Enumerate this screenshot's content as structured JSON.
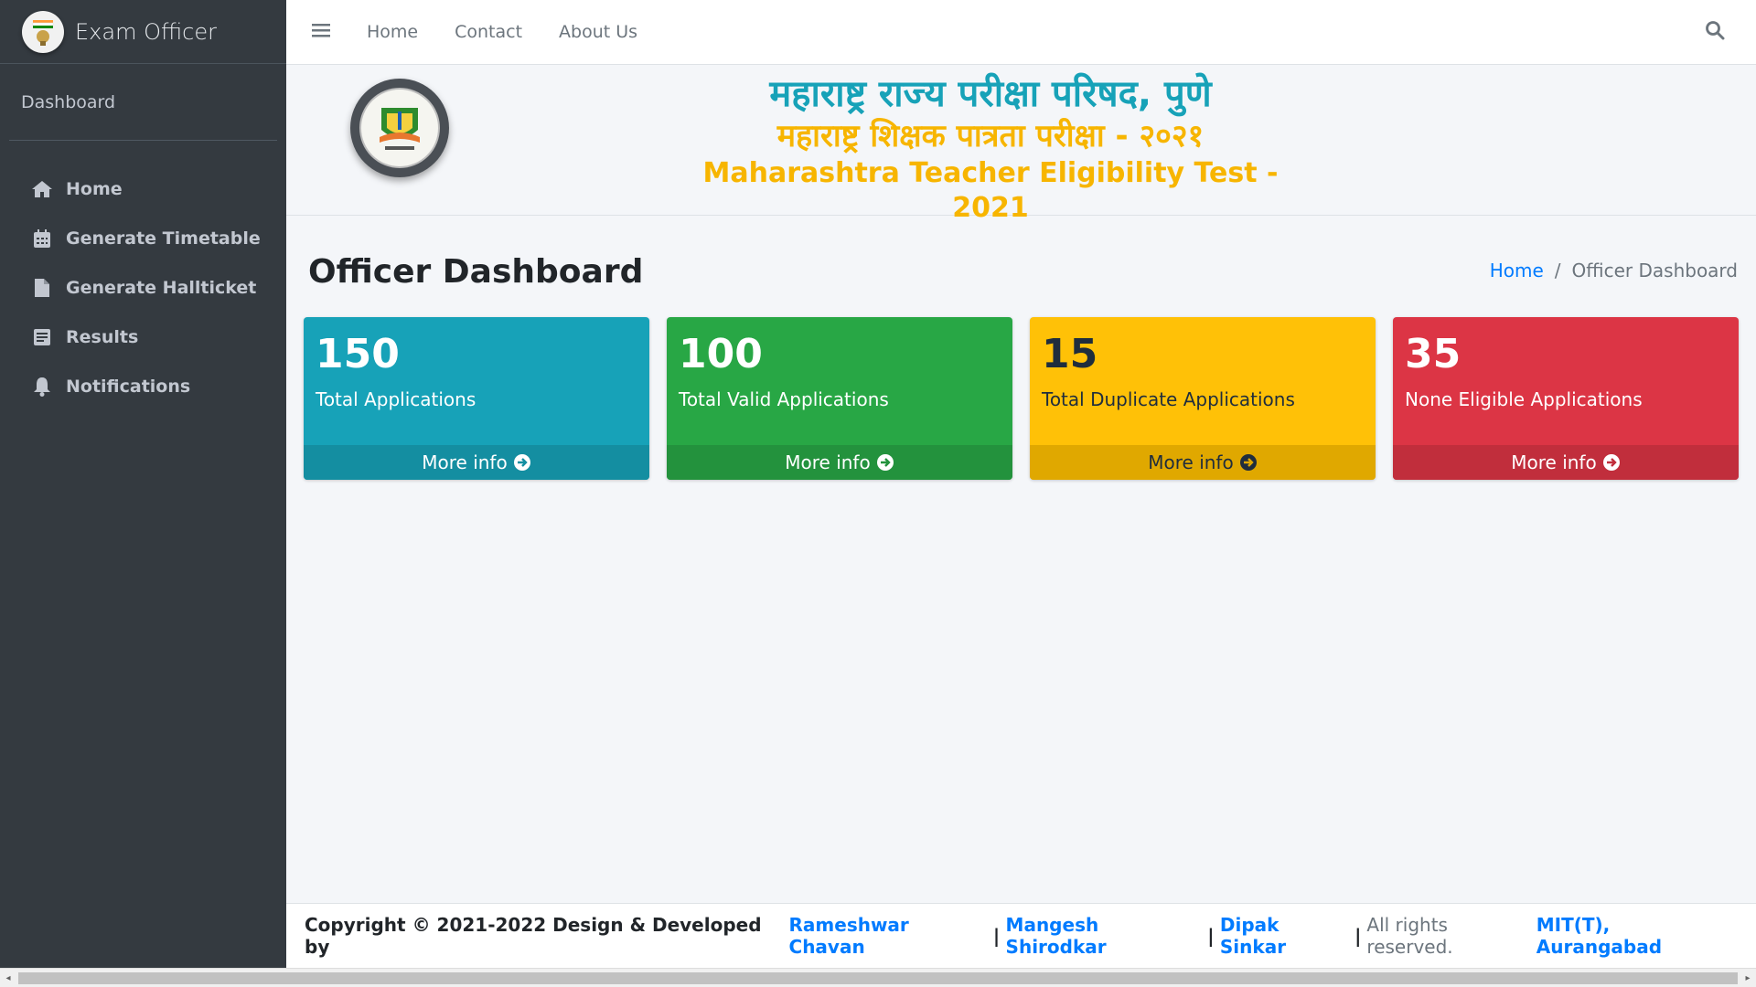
{
  "brand": {
    "title": "Exam Officer"
  },
  "sidebar": {
    "panel_label": "Dashboard",
    "items": [
      {
        "label": "Home",
        "icon": "home-icon"
      },
      {
        "label": "Generate Timetable",
        "icon": "calendar-icon"
      },
      {
        "label": "Generate Hallticket",
        "icon": "file-icon"
      },
      {
        "label": "Results",
        "icon": "list-icon"
      },
      {
        "label": "Notifications",
        "icon": "bell-icon"
      }
    ]
  },
  "topnav": {
    "links": [
      "Home",
      "Contact",
      "About Us"
    ]
  },
  "banner": {
    "line1": "महाराष्ट्र राज्य परीक्षा परिषद, पुणे",
    "line2": "महाराष्ट्र शिक्षक पात्रता परीक्षा - २०२१",
    "line3": "Maharashtra Teacher Eligibility Test - 2021"
  },
  "page": {
    "title": "Officer Dashboard",
    "breadcrumb": {
      "home": "Home",
      "separator": "/",
      "current": "Officer Dashboard"
    }
  },
  "stats": [
    {
      "value": "150",
      "label": "Total Applications",
      "footer": "More info",
      "color": "#17a2b8"
    },
    {
      "value": "100",
      "label": "Total Valid Applications",
      "footer": "More info",
      "color": "#28a745"
    },
    {
      "value": "15",
      "label": "Total Duplicate Applications",
      "footer": "More info",
      "color": "#ffc107"
    },
    {
      "value": "35",
      "label": "None Eligible Applications",
      "footer": "More info",
      "color": "#dc3545"
    }
  ],
  "footer": {
    "copyright": "Copyright © 2021-2022 Design & Developed by",
    "authors": [
      "Rameshwar Chavan",
      "Mangesh Shirodkar",
      "Dipak Sinkar"
    ],
    "separator": "|",
    "rights": "All rights reserved.",
    "institute": "MIT(T), Aurangabad"
  }
}
